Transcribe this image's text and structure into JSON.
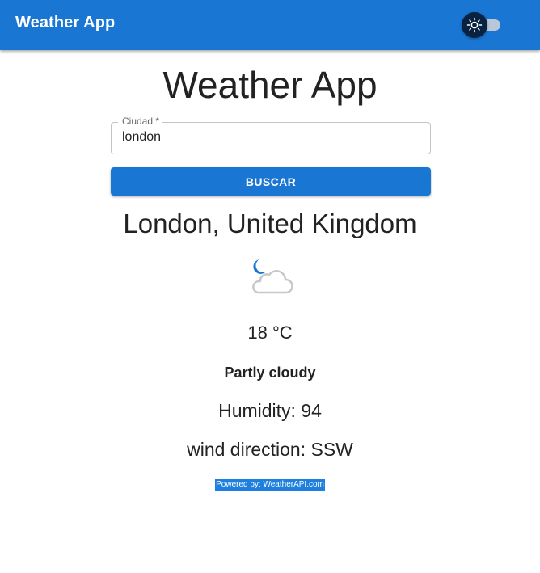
{
  "appbar": {
    "title": "Weather App",
    "theme_toggle_icon": "sun-icon",
    "theme_toggle_checked": false
  },
  "main": {
    "title": "Weather App",
    "search": {
      "label": "Ciudad *",
      "value": "london",
      "button_label": "BUSCAR"
    },
    "weather": {
      "location": "London, United Kingdom",
      "icon": "partly-cloudy-night-icon",
      "temperature": "18 °C",
      "condition": "Partly cloudy",
      "humidity": "Humidity: 94",
      "wind_direction": "wind direction: SSW"
    },
    "attribution": "Powered by: WeatherAPI.com"
  },
  "colors": {
    "primary": "#1976d2",
    "toggle_thumb": "#082240",
    "attribution_highlight": "#1e7fde",
    "moon": "#1976d2",
    "cloud": "#c8c8c8"
  }
}
